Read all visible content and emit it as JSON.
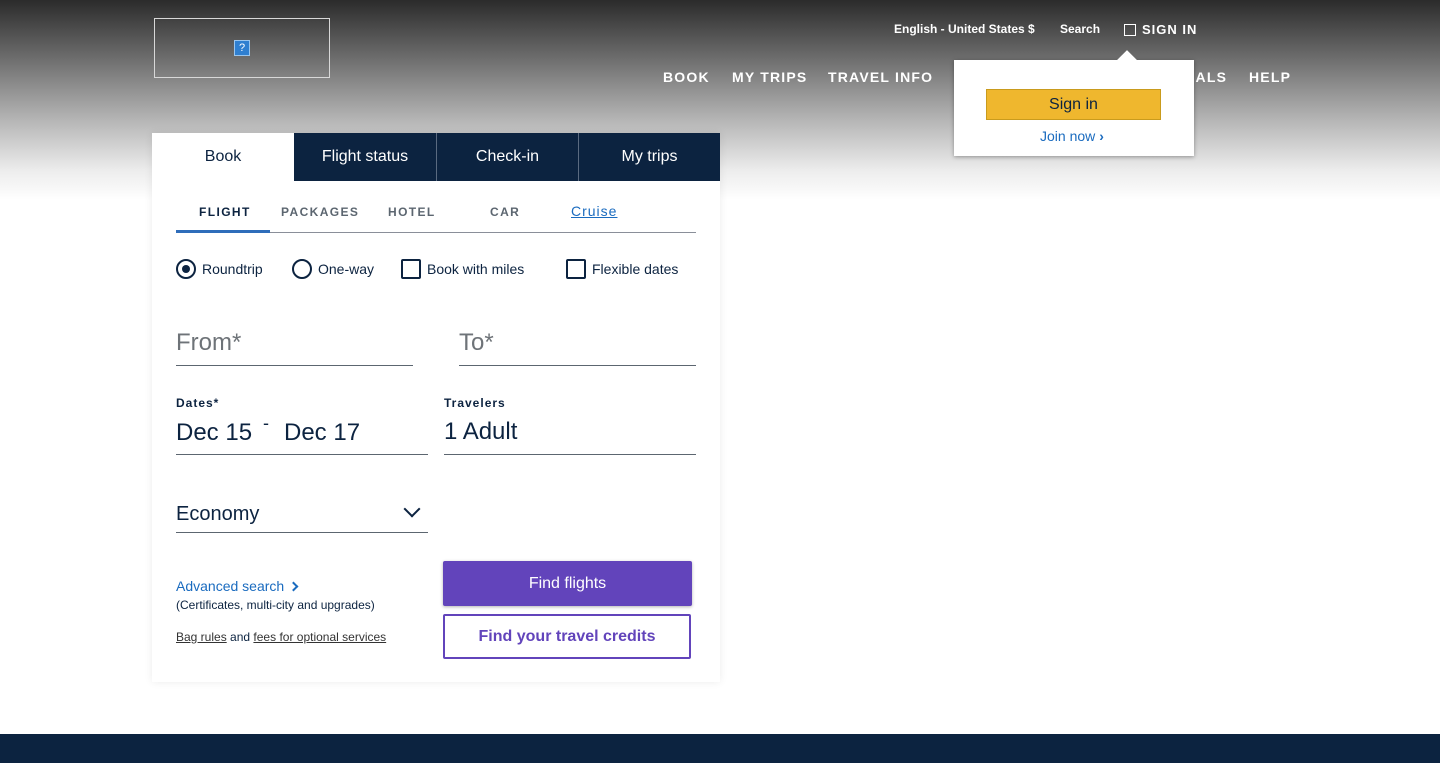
{
  "utility": {
    "language": "English - United States $",
    "search": "Search",
    "sign_in": "SIGN IN"
  },
  "nav": {
    "items": [
      "BOOK",
      "MY TRIPS",
      "TRAVEL INFO",
      "EALS",
      "HELP"
    ]
  },
  "popover": {
    "sign_in_button": "Sign in",
    "join_now": "Join now"
  },
  "booking": {
    "tabs": [
      "Book",
      "Flight status",
      "Check-in",
      "My trips"
    ],
    "subtabs": [
      "FLIGHT",
      "PACKAGES",
      "HOTEL",
      "CAR",
      "Cruise"
    ],
    "options": {
      "roundtrip": "Roundtrip",
      "oneway": "One-way",
      "miles": "Book with miles",
      "flexible": "Flexible dates"
    },
    "from_placeholder": "From*",
    "to_placeholder": "To*",
    "dates_label": "Dates*",
    "date_start": "Dec 15",
    "date_sep": "-",
    "date_end": "Dec 17",
    "travelers_label": "Travelers",
    "travelers_value": "1 Adult",
    "cabin": "Economy",
    "advanced_search": "Advanced search",
    "advanced_sub": "(Certificates, multi-city and upgrades)",
    "bag_rules": "Bag rules",
    "and": "and",
    "fees": "fees for optional services",
    "find_flights": "Find flights",
    "find_credits": "Find your travel credits"
  },
  "colors": {
    "navy": "#0c2340",
    "purple": "#6244bb",
    "gold": "#efb72e",
    "link_blue": "#1a6bbf"
  }
}
